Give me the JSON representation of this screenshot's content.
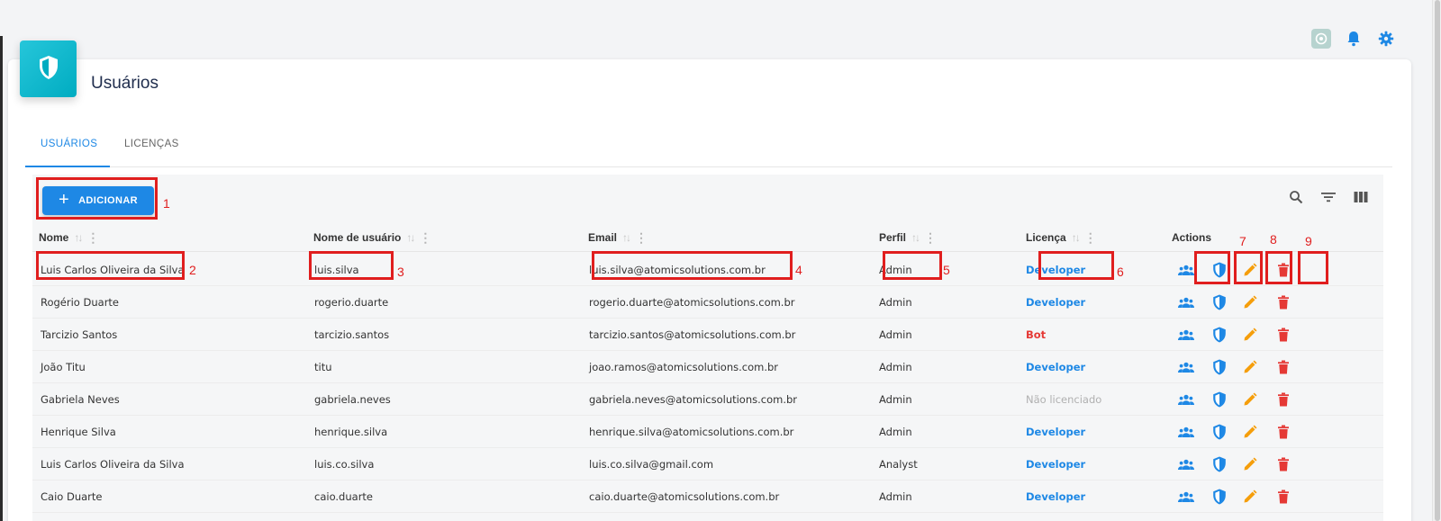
{
  "page": {
    "title": "Usuários",
    "tabs": [
      {
        "label": "USUÁRIOS",
        "active": true
      },
      {
        "label": "LICENÇAS",
        "active": false
      }
    ]
  },
  "top_icons": [
    "ai-assistant-icon",
    "bell-icon",
    "gear-icon"
  ],
  "toolbar": {
    "add_label": "ADICIONAR",
    "icons": [
      "search-icon",
      "filter-icon",
      "columns-icon"
    ]
  },
  "table": {
    "columns": [
      "Nome",
      "Nome de usuário",
      "Email",
      "Perfil",
      "Licença",
      "Actions"
    ],
    "rows": [
      {
        "name": "Luis Carlos Oliveira da Silva",
        "username": "luis.silva",
        "email": "luis.silva@atomicsolutions.com.br",
        "profile": "Admin",
        "license": "Developer",
        "license_type": "dev"
      },
      {
        "name": "Rogério Duarte",
        "username": "rogerio.duarte",
        "email": "rogerio.duarte@atomicsolutions.com.br",
        "profile": "Admin",
        "license": "Developer",
        "license_type": "dev"
      },
      {
        "name": "Tarcizio Santos",
        "username": "tarcizio.santos",
        "email": "tarcizio.santos@atomicsolutions.com.br",
        "profile": "Admin",
        "license": "Bot",
        "license_type": "bot"
      },
      {
        "name": "João Titu",
        "username": "titu",
        "email": "joao.ramos@atomicsolutions.com.br",
        "profile": "Admin",
        "license": "Developer",
        "license_type": "dev"
      },
      {
        "name": "Gabriela Neves",
        "username": "gabriela.neves",
        "email": "gabriela.neves@atomicsolutions.com.br",
        "profile": "Admin",
        "license": "Não licenciado",
        "license_type": "none"
      },
      {
        "name": "Henrique Silva",
        "username": "henrique.silva",
        "email": "henrique.silva@atomicsolutions.com.br",
        "profile": "Admin",
        "license": "Developer",
        "license_type": "dev"
      },
      {
        "name": "Luis Carlos Oliveira da Silva",
        "username": "luis.co.silva",
        "email": "luis.co.silva@gmail.com",
        "profile": "Analyst",
        "license": "Developer",
        "license_type": "dev"
      },
      {
        "name": "Caio Duarte",
        "username": "caio.duarte",
        "email": "caio.duarte@atomicsolutions.com.br",
        "profile": "Admin",
        "license": "Developer",
        "license_type": "dev"
      }
    ],
    "action_icons": [
      "users-icon",
      "shield-icon",
      "pencil-icon",
      "trash-icon"
    ]
  },
  "annotations": [
    "1",
    "2",
    "3",
    "4",
    "5",
    "6",
    "7",
    "8",
    "9"
  ],
  "colors": {
    "primary": "#1e88e5",
    "danger": "#e53935",
    "edit": "#f59e0b",
    "badge": "#00acc1",
    "annotation": "#e01e1e"
  }
}
